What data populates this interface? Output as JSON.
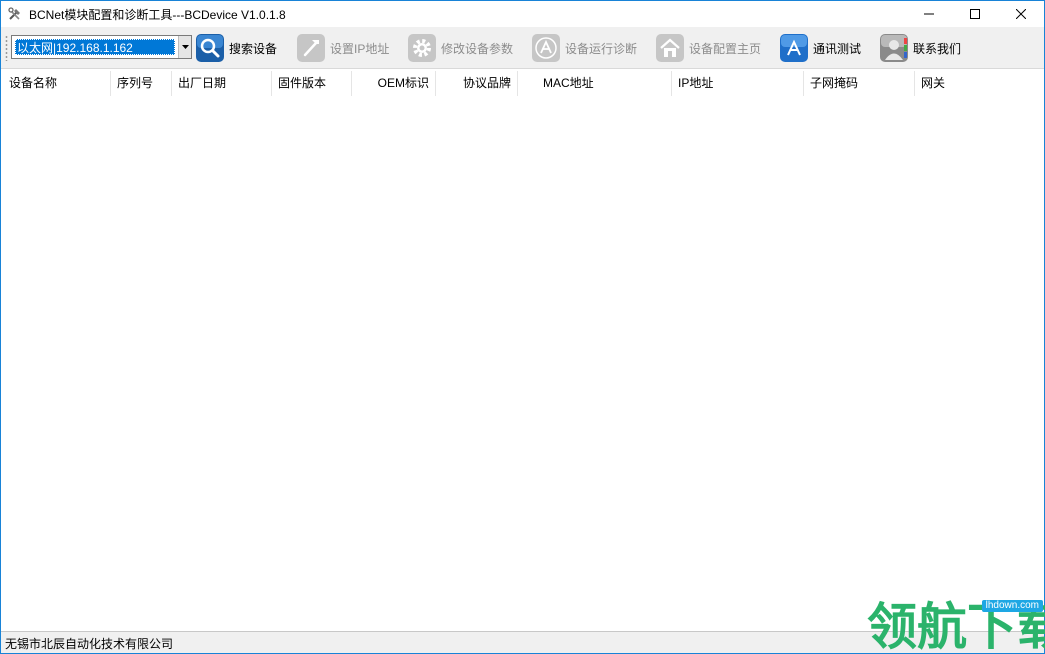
{
  "window": {
    "title": "BCNet模块配置和诊断工具---BCDevice V1.0.1.8"
  },
  "toolbar": {
    "interface_select": "以太网|192.168.1.162",
    "buttons": [
      {
        "label": "搜索设备",
        "icon": "search-icon",
        "enabled": true
      },
      {
        "label": "设置IP地址",
        "icon": "hammer-icon",
        "enabled": false
      },
      {
        "label": "修改设备参数",
        "icon": "gear-icon",
        "enabled": false
      },
      {
        "label": "设备运行诊断",
        "icon": "appstore-icon",
        "enabled": false
      },
      {
        "label": "设备配置主页",
        "icon": "home-icon",
        "enabled": false
      },
      {
        "label": "通讯测试",
        "icon": "appstore-icon",
        "enabled": true
      },
      {
        "label": "联系我们",
        "icon": "contact-icon",
        "enabled": true
      }
    ]
  },
  "table": {
    "columns": [
      "设备名称",
      "序列号",
      "出厂日期",
      "固件版本",
      "OEM标识",
      "协议品牌",
      "MAC地址",
      "IP地址",
      "子网掩码",
      "网关"
    ],
    "rows": []
  },
  "statusbar": {
    "company": "无锡市北辰自动化技术有限公司"
  },
  "watermark": {
    "text": "领航下载",
    "url": "lhdown.com"
  },
  "colors": {
    "selection": "#0078d7",
    "disabled_text": "#8c8c8c",
    "watermark_green": "#2bb36b",
    "watermark_blue": "#1ea7e4"
  }
}
